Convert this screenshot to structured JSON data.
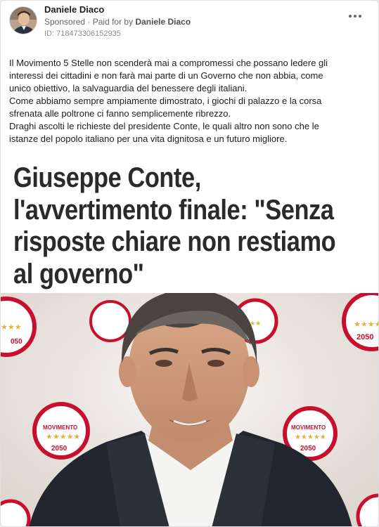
{
  "post": {
    "author": "Daniele Diaco",
    "sponsored_label": "Sponsored",
    "separator": "·",
    "paid_for_prefix": "Paid for by",
    "paid_for_name": "Daniele Diaco",
    "ad_id": "ID: 718473306152935",
    "more_icon": "more-horizontal-icon",
    "text_lines": [
      "Il Movimento 5 Stelle non scenderà mai a compromessi che possano ledere gli",
      "interessi dei cittadini e non farà mai parte di un Governo che non abbia, come",
      "unico obiettivo, la salvaguardia del benessere degli italiani.",
      "Come abbiamo sempre ampiamente dimostrato, i giochi di palazzo e la corsa",
      "sfrenata alle poltrone ci fanno semplicemente ribrezzo.",
      "Draghi ascolti le richieste del presidente Conte, le quali altro non sono che le",
      "istanze del popolo italiano per una vita dignitosa e un futuro migliore."
    ]
  },
  "media": {
    "headline_lines": [
      "Giuseppe Conte,",
      "l'avvertimento finale: \"Senza",
      "risposte chiare non restiamo",
      "al governo\""
    ],
    "logo_text": "MOVIMENTO",
    "logo_year": "2050"
  },
  "colors": {
    "logo_red": "#c8102e",
    "logo_gold": "#e3b23c",
    "suit": "#23262d"
  }
}
